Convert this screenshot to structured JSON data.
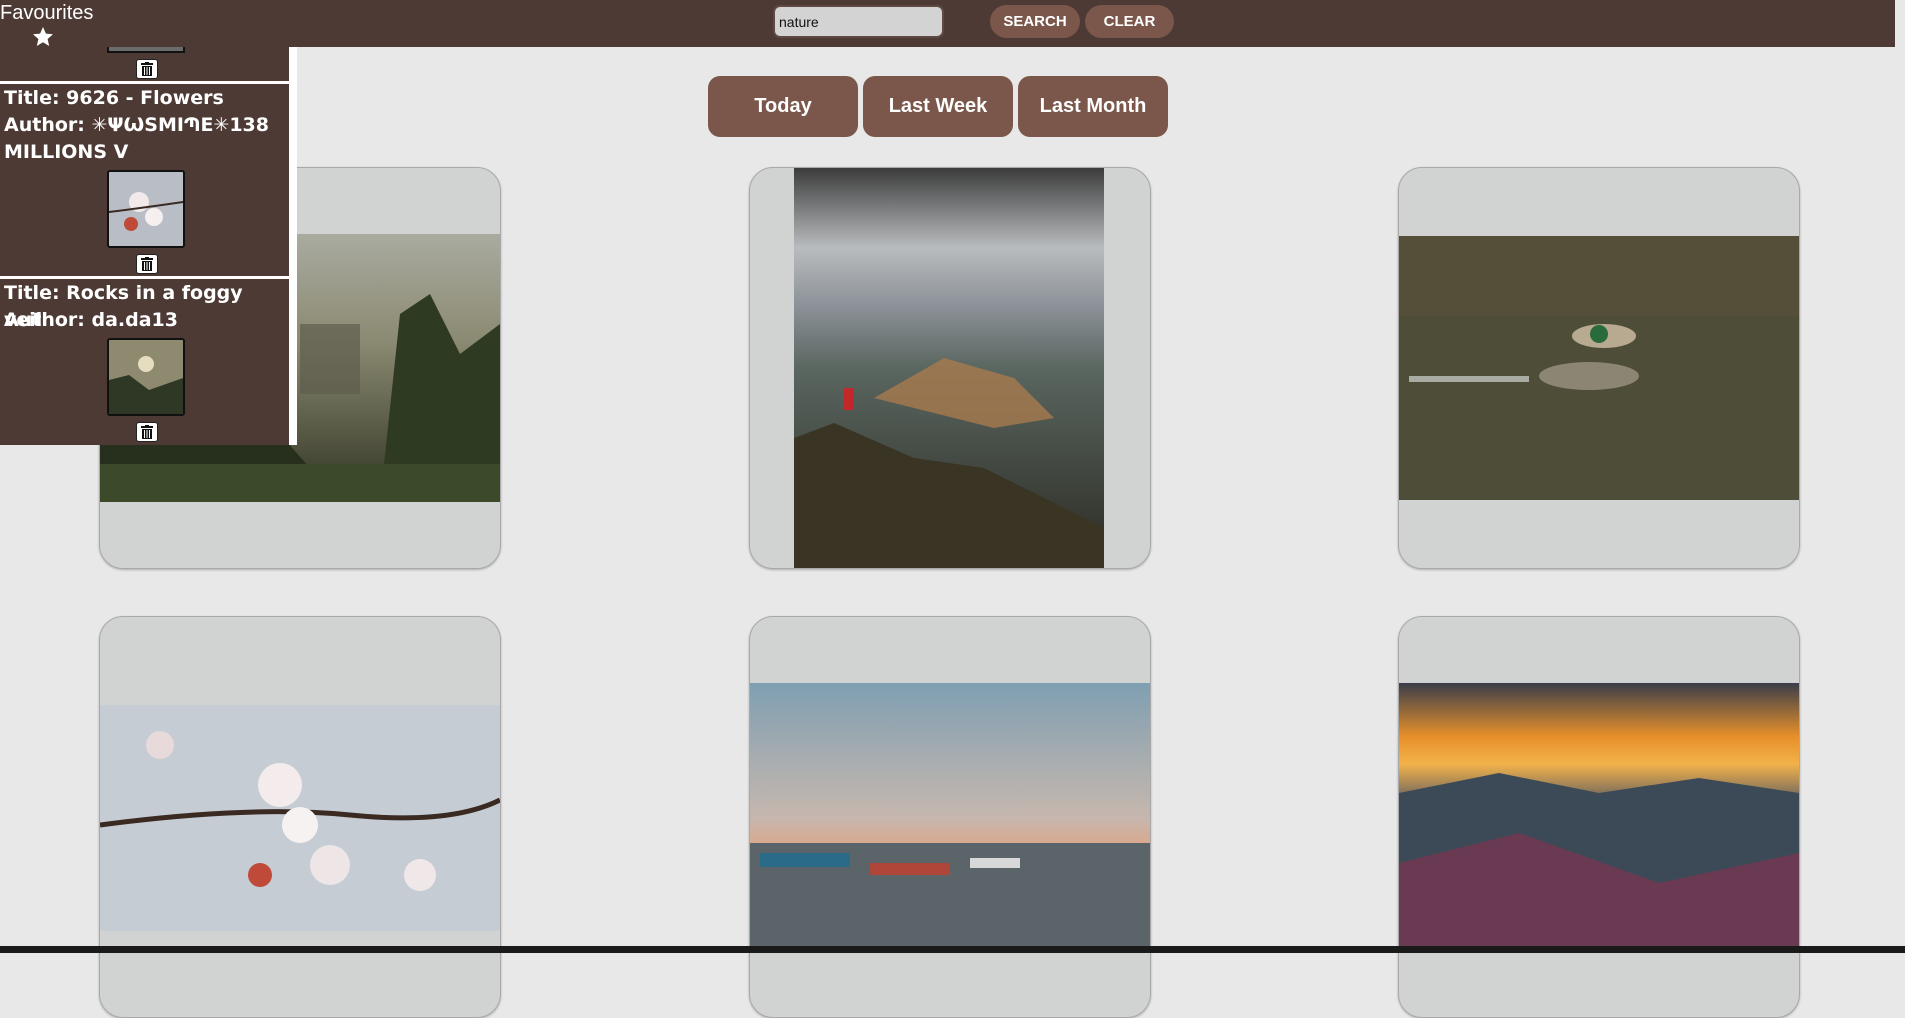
{
  "header": {
    "favourites_label": "Favourites",
    "search": {
      "value": "nature",
      "placeholder": ""
    },
    "search_label": "SEARCH",
    "clear_label": "CLEAR"
  },
  "date_filter": {
    "today": "Today",
    "last_week": "Last Week",
    "last_month": "Last Month"
  },
  "favourites": [
    {
      "title": "Title: 9626 - Flowers",
      "author": "Author: ✳ΨѠSMIՊE✳138 MILLIONS V"
    },
    {
      "title": "Title: Rocks in a foggy veil",
      "author": "Author: da.da13"
    }
  ],
  "icons": {
    "favourites": "star-icon",
    "remove": "trash-icon"
  },
  "colors": {
    "brand_dark": "#4e3a34",
    "button": "#7a574a",
    "page_bg": "#e8e8e8",
    "card_bg": "#d1d3d2"
  }
}
